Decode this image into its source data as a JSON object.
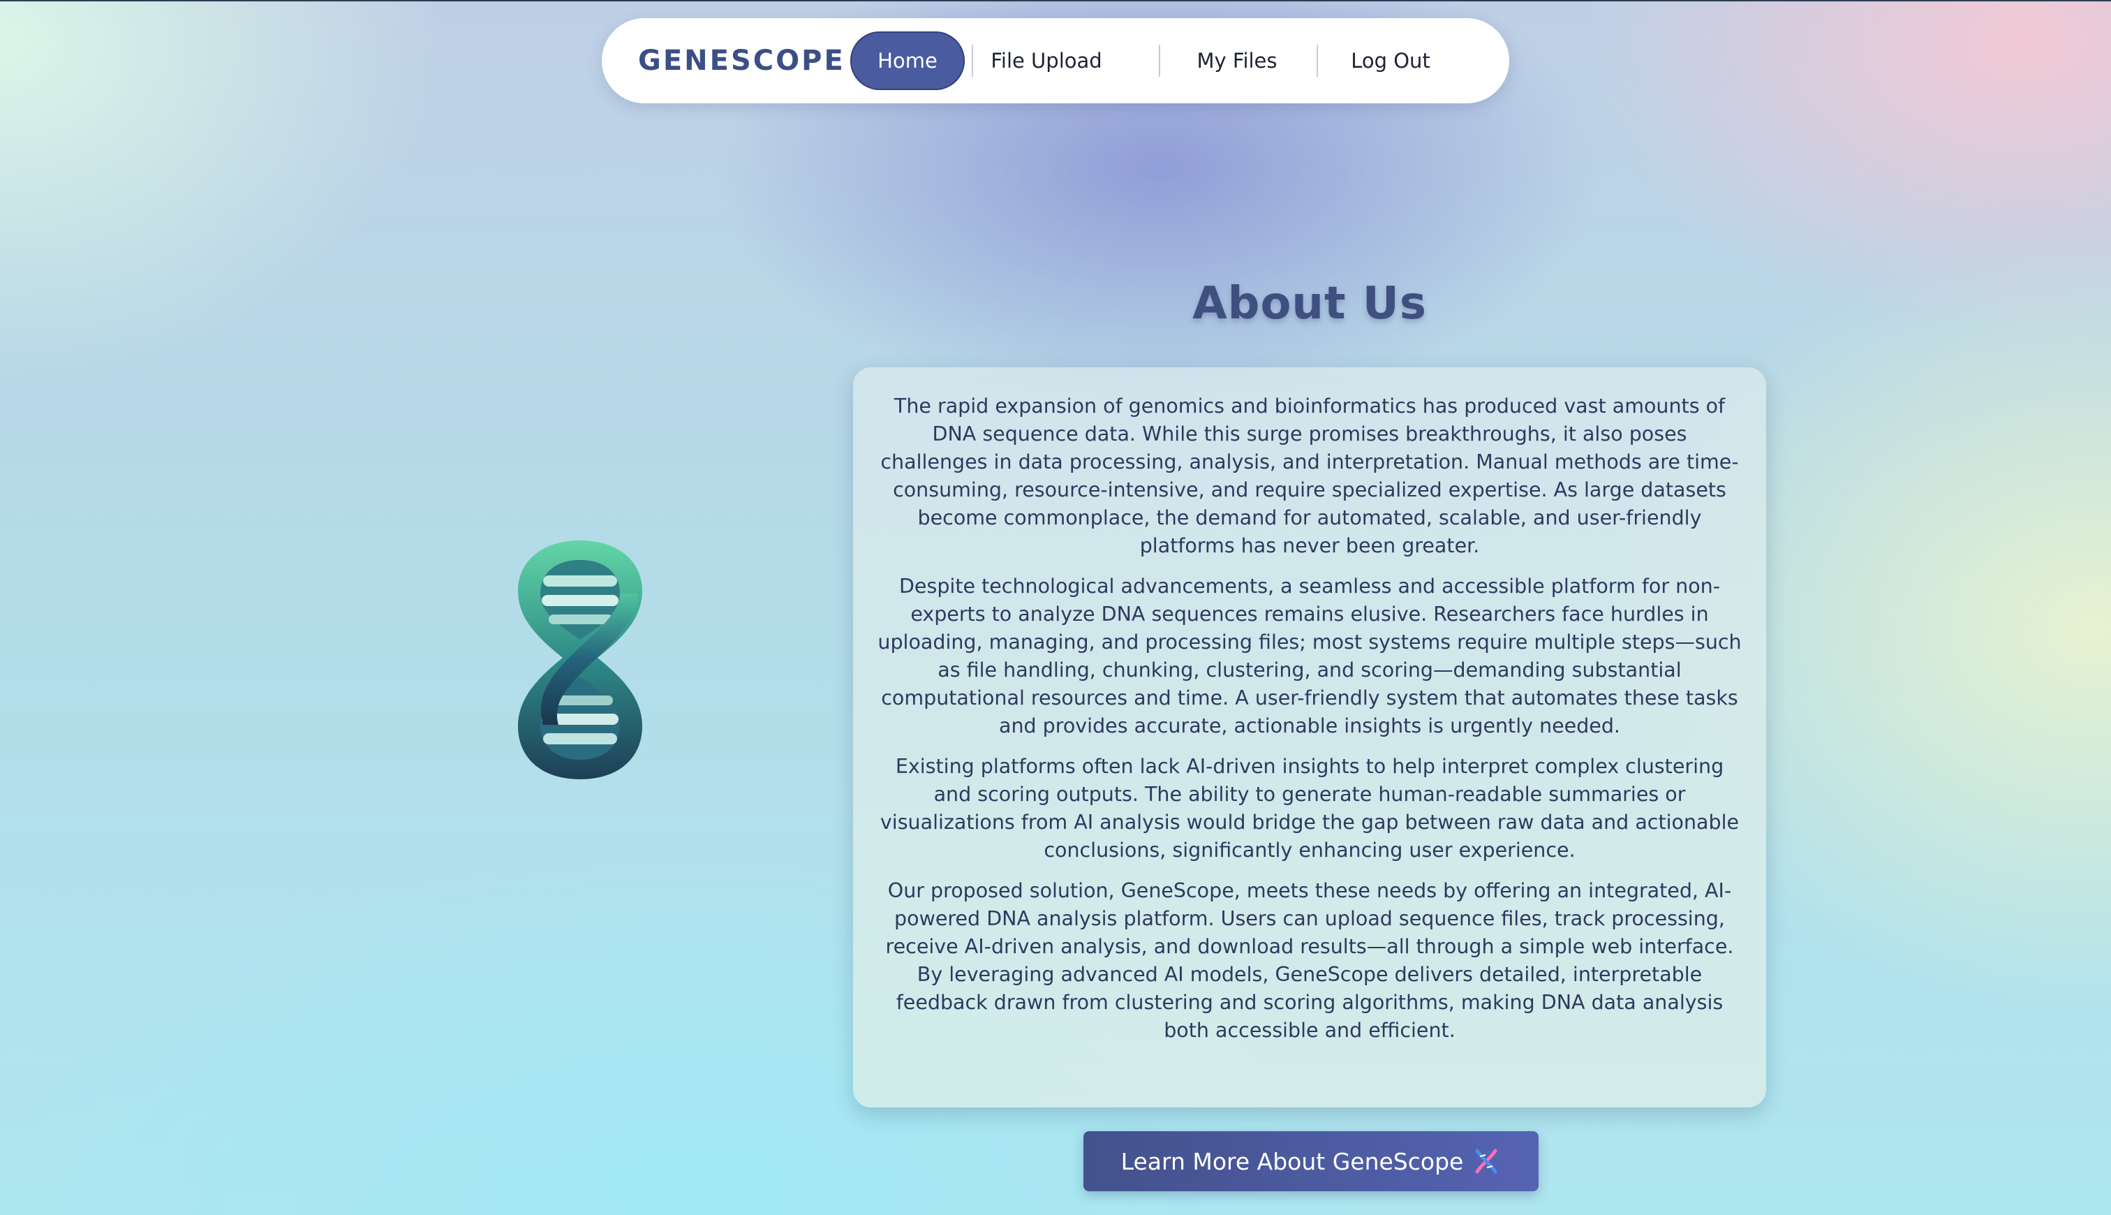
{
  "nav": {
    "brand": "GENESCOPE",
    "items": [
      {
        "label": "Home",
        "active": true
      },
      {
        "label": "File Upload",
        "active": false
      },
      {
        "label": "My Files",
        "active": false
      },
      {
        "label": "Log Out",
        "active": false
      }
    ]
  },
  "hero": {
    "icon": "dna-helix-icon"
  },
  "about": {
    "title": "About Us",
    "paragraphs": [
      "The rapid expansion of genomics and bioinformatics has produced vast amounts of DNA sequence data. While this surge promises breakthroughs, it also poses challenges in data processing, analysis, and interpretation. Manual methods are time-consuming, resource-intensive, and require specialized expertise. As large datasets become commonplace, the demand for automated, scalable, and user-friendly platforms has never been greater.",
      "Despite technological advancements, a seamless and accessible platform for non-experts to analyze DNA sequences remains elusive. Researchers face hurdles in uploading, managing, and processing files; most systems require multiple steps—such as file handling, chunking, clustering, and scoring—demanding substantial computational resources and time. A user-friendly system that automates these tasks and provides accurate, actionable insights is urgently needed.",
      "Existing platforms often lack AI-driven insights to help interpret complex clustering and scoring outputs. The ability to generate human-readable summaries or visualizations from AI analysis would bridge the gap between raw data and actionable conclusions, significantly enhancing user experience.",
      "Our proposed solution, GeneScope, meets these needs by offering an integrated, AI-powered DNA analysis platform. Users can upload sequence files, track processing, receive AI-driven analysis, and download results—all through a simple web interface. By leveraging advanced AI models, GeneScope delivers detailed, interpretable feedback drawn from clustering and scoring algorithms, making DNA data analysis both accessible and efficient."
    ],
    "cta_label": "Learn More About GeneScope"
  },
  "colors": {
    "accent": "#4a5ba0",
    "brand_text": "#3b4f86",
    "body_text": "#2d3a5e"
  }
}
